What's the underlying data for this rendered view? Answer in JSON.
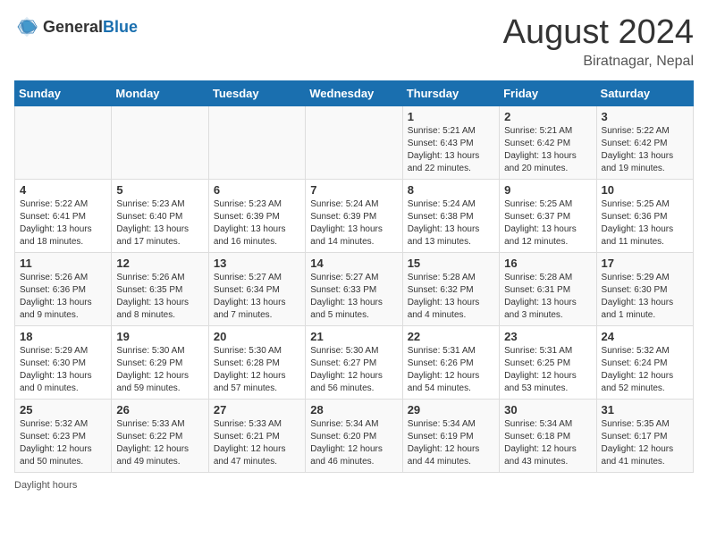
{
  "header": {
    "logo_general": "General",
    "logo_blue": "Blue",
    "month_year": "August 2024",
    "location": "Biratnagar, Nepal"
  },
  "weekdays": [
    "Sunday",
    "Monday",
    "Tuesday",
    "Wednesday",
    "Thursday",
    "Friday",
    "Saturday"
  ],
  "weeks": [
    [
      {
        "day": "",
        "info": ""
      },
      {
        "day": "",
        "info": ""
      },
      {
        "day": "",
        "info": ""
      },
      {
        "day": "",
        "info": ""
      },
      {
        "day": "1",
        "info": "Sunrise: 5:21 AM\nSunset: 6:43 PM\nDaylight: 13 hours and 22 minutes."
      },
      {
        "day": "2",
        "info": "Sunrise: 5:21 AM\nSunset: 6:42 PM\nDaylight: 13 hours and 20 minutes."
      },
      {
        "day": "3",
        "info": "Sunrise: 5:22 AM\nSunset: 6:42 PM\nDaylight: 13 hours and 19 minutes."
      }
    ],
    [
      {
        "day": "4",
        "info": "Sunrise: 5:22 AM\nSunset: 6:41 PM\nDaylight: 13 hours and 18 minutes."
      },
      {
        "day": "5",
        "info": "Sunrise: 5:23 AM\nSunset: 6:40 PM\nDaylight: 13 hours and 17 minutes."
      },
      {
        "day": "6",
        "info": "Sunrise: 5:23 AM\nSunset: 6:39 PM\nDaylight: 13 hours and 16 minutes."
      },
      {
        "day": "7",
        "info": "Sunrise: 5:24 AM\nSunset: 6:39 PM\nDaylight: 13 hours and 14 minutes."
      },
      {
        "day": "8",
        "info": "Sunrise: 5:24 AM\nSunset: 6:38 PM\nDaylight: 13 hours and 13 minutes."
      },
      {
        "day": "9",
        "info": "Sunrise: 5:25 AM\nSunset: 6:37 PM\nDaylight: 13 hours and 12 minutes."
      },
      {
        "day": "10",
        "info": "Sunrise: 5:25 AM\nSunset: 6:36 PM\nDaylight: 13 hours and 11 minutes."
      }
    ],
    [
      {
        "day": "11",
        "info": "Sunrise: 5:26 AM\nSunset: 6:36 PM\nDaylight: 13 hours and 9 minutes."
      },
      {
        "day": "12",
        "info": "Sunrise: 5:26 AM\nSunset: 6:35 PM\nDaylight: 13 hours and 8 minutes."
      },
      {
        "day": "13",
        "info": "Sunrise: 5:27 AM\nSunset: 6:34 PM\nDaylight: 13 hours and 7 minutes."
      },
      {
        "day": "14",
        "info": "Sunrise: 5:27 AM\nSunset: 6:33 PM\nDaylight: 13 hours and 5 minutes."
      },
      {
        "day": "15",
        "info": "Sunrise: 5:28 AM\nSunset: 6:32 PM\nDaylight: 13 hours and 4 minutes."
      },
      {
        "day": "16",
        "info": "Sunrise: 5:28 AM\nSunset: 6:31 PM\nDaylight: 13 hours and 3 minutes."
      },
      {
        "day": "17",
        "info": "Sunrise: 5:29 AM\nSunset: 6:30 PM\nDaylight: 13 hours and 1 minute."
      }
    ],
    [
      {
        "day": "18",
        "info": "Sunrise: 5:29 AM\nSunset: 6:30 PM\nDaylight: 13 hours and 0 minutes."
      },
      {
        "day": "19",
        "info": "Sunrise: 5:30 AM\nSunset: 6:29 PM\nDaylight: 12 hours and 59 minutes."
      },
      {
        "day": "20",
        "info": "Sunrise: 5:30 AM\nSunset: 6:28 PM\nDaylight: 12 hours and 57 minutes."
      },
      {
        "day": "21",
        "info": "Sunrise: 5:30 AM\nSunset: 6:27 PM\nDaylight: 12 hours and 56 minutes."
      },
      {
        "day": "22",
        "info": "Sunrise: 5:31 AM\nSunset: 6:26 PM\nDaylight: 12 hours and 54 minutes."
      },
      {
        "day": "23",
        "info": "Sunrise: 5:31 AM\nSunset: 6:25 PM\nDaylight: 12 hours and 53 minutes."
      },
      {
        "day": "24",
        "info": "Sunrise: 5:32 AM\nSunset: 6:24 PM\nDaylight: 12 hours and 52 minutes."
      }
    ],
    [
      {
        "day": "25",
        "info": "Sunrise: 5:32 AM\nSunset: 6:23 PM\nDaylight: 12 hours and 50 minutes."
      },
      {
        "day": "26",
        "info": "Sunrise: 5:33 AM\nSunset: 6:22 PM\nDaylight: 12 hours and 49 minutes."
      },
      {
        "day": "27",
        "info": "Sunrise: 5:33 AM\nSunset: 6:21 PM\nDaylight: 12 hours and 47 minutes."
      },
      {
        "day": "28",
        "info": "Sunrise: 5:34 AM\nSunset: 6:20 PM\nDaylight: 12 hours and 46 minutes."
      },
      {
        "day": "29",
        "info": "Sunrise: 5:34 AM\nSunset: 6:19 PM\nDaylight: 12 hours and 44 minutes."
      },
      {
        "day": "30",
        "info": "Sunrise: 5:34 AM\nSunset: 6:18 PM\nDaylight: 12 hours and 43 minutes."
      },
      {
        "day": "31",
        "info": "Sunrise: 5:35 AM\nSunset: 6:17 PM\nDaylight: 12 hours and 41 minutes."
      }
    ]
  ],
  "footer": {
    "label": "Daylight hours"
  }
}
